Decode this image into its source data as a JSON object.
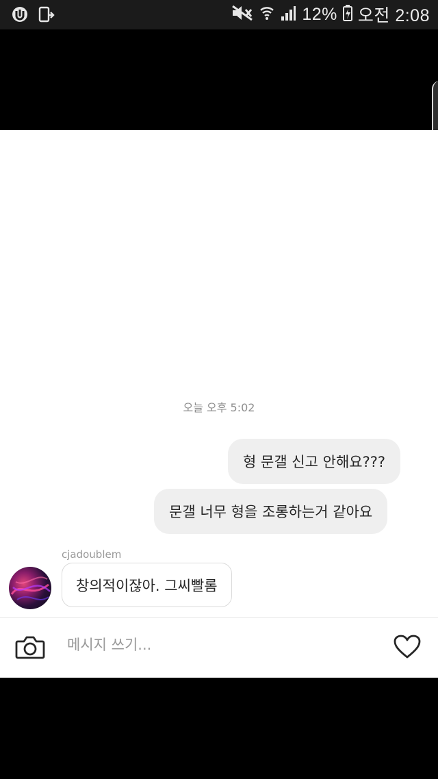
{
  "status_bar": {
    "battery": "12%",
    "time": "오전 2:08"
  },
  "chat": {
    "timestamp": "오늘 오후 5:02",
    "messages": [
      {
        "direction": "outgoing",
        "text": "형 문갤 신고 안해요???"
      },
      {
        "direction": "outgoing",
        "text": "문갤 너무 형을 조롱하는거 같아요"
      },
      {
        "direction": "incoming",
        "sender": "cjadoublem",
        "text": "창의적이잖아. 그씨빨롬"
      }
    ]
  },
  "composer": {
    "placeholder": "메시지 쓰기...",
    "camera_icon": "camera-icon",
    "like_icon": "heart-icon"
  }
}
